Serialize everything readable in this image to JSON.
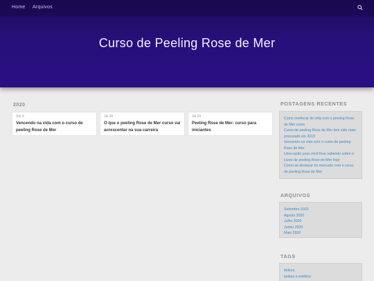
{
  "nav": {
    "home": "Home",
    "archives": "Arquivos",
    "search_icon": "search-icon"
  },
  "site": {
    "title": "Curso de Peeling Rose de Mer"
  },
  "main": {
    "year": "2020",
    "posts": [
      {
        "date": "Set 3",
        "title": "Vencendo na vida com o curso de peeling Rose de Mer"
      },
      {
        "date": "Jul 30",
        "title": "O que o peeling Rose de Mer curso vai acrescentar na sua carreira"
      },
      {
        "date": "Jul 29",
        "title": "Peeling Rose de Mer: curso para iniciantes"
      }
    ]
  },
  "sidebar": {
    "recent_heading": "POSTAGENS RECENTES",
    "recent": [
      "Como melhorar de vida com o peeling Rose de Mer curso",
      "Curso de peeling Rose de Mer tem sido mais procurado em 2019",
      "Vencendo na vida com o curso de peeling Rose de Mer",
      "Uma razão para você ficar sabendo sobre o curso de peeling Rose de Mer hoje",
      "Como se destacar no mercado com o curso de peeling Rose de Mer"
    ],
    "archives_heading": "ARQUIVOS",
    "archives": [
      "Setembro 2020",
      "Agosto 2020",
      "Julho 2020",
      "Junho 2020",
      "Maio 2020"
    ],
    "tags_heading": "TAGS",
    "tags": [
      "beleza",
      "beleza e estética"
    ]
  }
}
